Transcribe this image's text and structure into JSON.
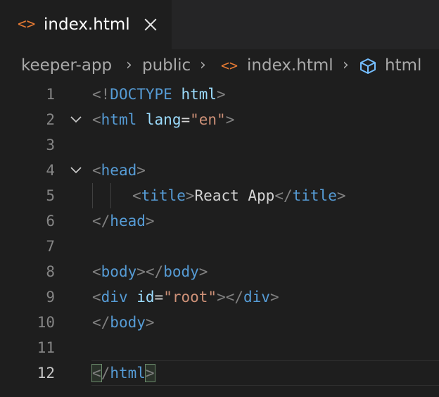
{
  "tab": {
    "icon": "html-file-icon",
    "label": "index.html"
  },
  "breadcrumb": {
    "items": [
      "keeper-app",
      "public",
      "index.html",
      "html"
    ],
    "separator": "›"
  },
  "editor": {
    "active_line": 12,
    "lines": [
      {
        "n": "1"
      },
      {
        "n": "2"
      },
      {
        "n": "3"
      },
      {
        "n": "4"
      },
      {
        "n": "5"
      },
      {
        "n": "6"
      },
      {
        "n": "7"
      },
      {
        "n": "8"
      },
      {
        "n": "9"
      },
      {
        "n": "10"
      },
      {
        "n": "11"
      },
      {
        "n": "12"
      }
    ],
    "tokens": {
      "l1_lt": "<!",
      "l1_doctype": "DOCTYPE",
      "l1_html": "html",
      "l1_gt": ">",
      "l2_lt": "<",
      "l2_tag": "html",
      "l2_attr": "lang",
      "l2_eq": "=",
      "l2_val": "\"en\"",
      "l2_gt": ">",
      "l4_lt": "<",
      "l4_tag": "head",
      "l4_gt": ">",
      "l5_lt": "<",
      "l5_tag": "title",
      "l5_gt": ">",
      "l5_text": "React App",
      "l5_lt2": "</",
      "l5_tag2": "title",
      "l5_gt2": ">",
      "l6_lt": "</",
      "l6_tag": "head",
      "l6_gt": ">",
      "l8_lt": "<",
      "l8_tag": "body",
      "l8_gt": ">",
      "l8_lt2": "</",
      "l8_tag2": "body",
      "l8_gt2": ">",
      "l9_lt": "<",
      "l9_tag": "div",
      "l9_attr": "id",
      "l9_eq": "=",
      "l9_val": "\"root\"",
      "l9_gt": ">",
      "l9_lt2": "</",
      "l9_tag2": "div",
      "l9_gt2": ">",
      "l10_lt": "</",
      "l10_tag": "body",
      "l10_gt": ">",
      "l12_lt": "<",
      "l12_slash": "/",
      "l12_tag": "html",
      "l12_gt": ">"
    }
  },
  "colors": {
    "background": "#1e1e1e",
    "tab_bar": "#252526",
    "file_icon": "#e37933",
    "tag": "#569cd6",
    "attribute": "#9cdcfe",
    "string": "#ce9178"
  }
}
